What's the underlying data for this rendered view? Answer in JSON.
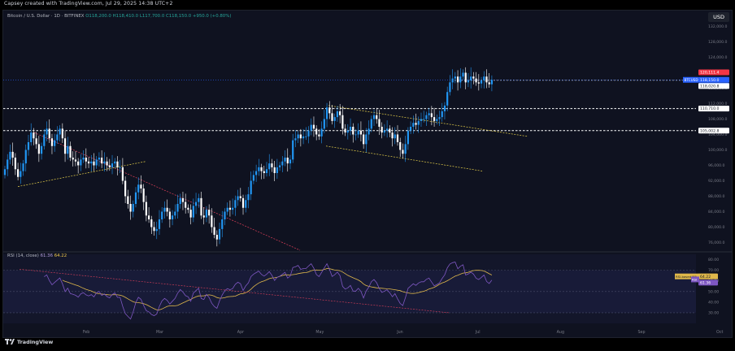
{
  "credit": "Capsey created with TradingView.com, Jul 29, 2025 14:38 UTC+2",
  "currency_button": "USD",
  "symbol": {
    "title": "Bitcoin / U.S. Dollar · 1D · BITFINEX",
    "open": "O118,200.0",
    "high": "H118,410.0",
    "low": "L117,700.0",
    "close": "C118,150.0",
    "change": "+950.0 (+0.80%)"
  },
  "rsi": {
    "label": "RSI (14, close)",
    "value": "61.36",
    "ma_value": "64.22",
    "ma_tag": "RSI-based MA",
    "ma_tag_value": "64.22",
    "rsi_tag": "RSI",
    "rsi_tag_value": "61.36"
  },
  "price_axis": [
    "132,000.0",
    "128,000.0",
    "124,000.0",
    "120,000.0",
    "116,000.0",
    "112,000.0",
    "108,000.0",
    "104,000.0",
    "100,000.0",
    "96,000.0",
    "92,000.0",
    "88,000.0",
    "84,000.0",
    "80,000.0",
    "76,000.0"
  ],
  "price_tags": {
    "high_tag": "120,111.4",
    "symbol_tag": "BTCUSD",
    "last_price": "118,150.0",
    "countdown": "11:21:22",
    "level_118": "118,020.8",
    "level_111": "110,710.0",
    "level_105": "105,002.8"
  },
  "rsi_axis": [
    "80.00",
    "70.00",
    "60.00",
    "50.00",
    "40.00",
    "30.00"
  ],
  "time_axis": [
    "Feb",
    "Mar",
    "Apr",
    "May",
    "Jun",
    "Jul",
    "Aug",
    "Sep",
    "Oct"
  ],
  "footer_brand": "TradingView",
  "colors": {
    "up": "#2196f3",
    "down": "#ffffff",
    "rsi_line": "#7e57c2",
    "rsi_ma": "#e0b84b",
    "trend_down": "#e0405a",
    "trend_yellow": "#e6d04a",
    "price_tag": "#2962ff",
    "high_tag": "#f23645"
  },
  "chart_data": {
    "type": "candlestick",
    "title": "Bitcoin / U.S. Dollar · 1D · BITFINEX",
    "y_range": [
      74000,
      134000
    ],
    "x_start": "2025-01-01",
    "closes": [
      95000,
      97500,
      99500,
      98000,
      95000,
      93000,
      94500,
      96500,
      100000,
      102000,
      104500,
      103000,
      101500,
      99000,
      101000,
      104000,
      105500,
      103000,
      101000,
      102500,
      104000,
      105500,
      103000,
      99000,
      101000,
      98000,
      97500,
      97000,
      96000,
      97500,
      98000,
      97000,
      96500,
      97000,
      96000,
      97500,
      98000,
      96500,
      97000,
      96000,
      95500,
      96500,
      97000,
      95500,
      95500,
      92000,
      88000,
      86000,
      84000,
      86000,
      89000,
      91000,
      90000,
      86500,
      83000,
      82000,
      80000,
      79000,
      79500,
      82000,
      84000,
      85000,
      84000,
      82000,
      83000,
      84000,
      86000,
      87500,
      86500,
      85000,
      84500,
      82500,
      85500,
      86500,
      87500,
      83000,
      82500,
      84500,
      83000,
      80000,
      78000,
      76800,
      79500,
      82000,
      84000,
      85000,
      84500,
      85000,
      87000,
      88000,
      87500,
      85000,
      87000,
      88500,
      92000,
      93500,
      94500,
      95500,
      94500,
      94000,
      95000,
      96500,
      95500,
      94000,
      95500,
      96000,
      97000,
      98000,
      96500,
      97500,
      102500,
      103000,
      104000,
      103000,
      103500,
      103500,
      105000,
      106500,
      105500,
      104000,
      103500,
      105500,
      108000,
      111000,
      109500,
      107500,
      108500,
      110000,
      109000,
      105500,
      104500,
      105000,
      106000,
      104000,
      104000,
      105000,
      104000,
      101500,
      104000,
      105500,
      108000,
      109000,
      108000,
      106000,
      104500,
      105000,
      105500,
      104500,
      103000,
      104000,
      102000,
      100000,
      99000,
      101500,
      105000,
      106000,
      107000,
      106500,
      107500,
      108000,
      108000,
      109000,
      109500,
      108500,
      107500,
      108000,
      108500,
      110000,
      111500,
      115000,
      117500,
      118500,
      119000,
      117500,
      119000,
      120000,
      117500,
      118000,
      119000,
      118500,
      117500,
      117200,
      118000,
      119000,
      117500,
      117000,
      118150
    ],
    "price_levels": [
      118020.8,
      110710.0,
      105002.8
    ],
    "last_price": 118150.0,
    "rsi_range": [
      20,
      85
    ],
    "rsi_levels": [
      70,
      50,
      30
    ],
    "x_labels": [
      "Feb",
      "Mar",
      "Apr",
      "May",
      "Jun",
      "Jul",
      "Aug",
      "Sep",
      "Oct"
    ]
  }
}
